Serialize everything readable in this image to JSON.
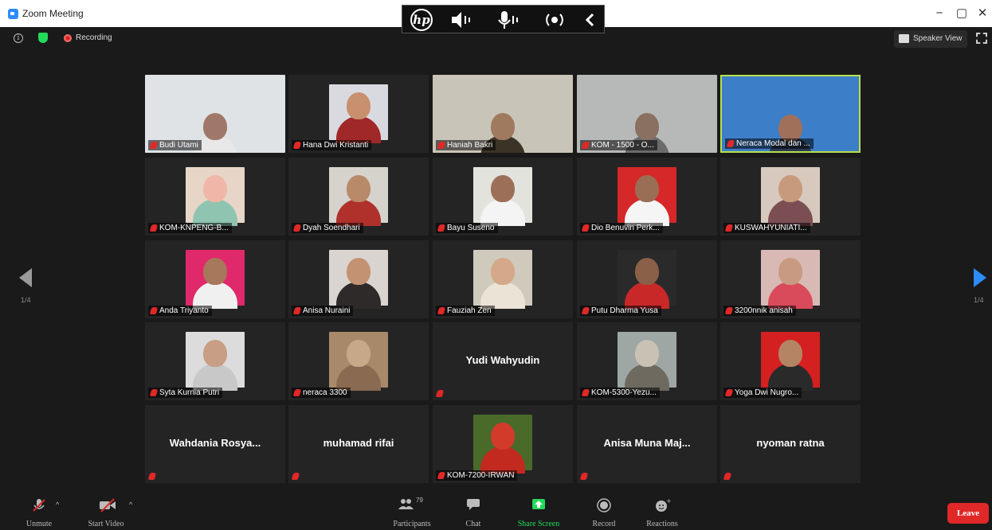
{
  "window": {
    "title": "Zoom Meeting",
    "min": "−",
    "restore": "▢",
    "close": "✕"
  },
  "hp_bar": {
    "logo": "hp",
    "items": [
      "speaker-icon",
      "mic-icon",
      "broadcast-icon",
      "collapse-icon"
    ]
  },
  "top": {
    "recording": "Recording",
    "speaker_view": "Speaker View"
  },
  "pagination": {
    "left": "1/4",
    "right": "1/4"
  },
  "participants": [
    {
      "name": "Budi Utami",
      "video": true,
      "bg": "#dfe3e6",
      "skin": "#a0786a",
      "cloth": "#e8e8e8",
      "full": true
    },
    {
      "name": "Hana Dwi Kristanti",
      "video": true,
      "bg": "#d9dadf",
      "skin": "#c8906e",
      "cloth": "#a02828"
    },
    {
      "name": "Haniah Bakri",
      "video": true,
      "bg": "#c9c4b8",
      "skin": "#a07a5e",
      "cloth": "#3a3326",
      "full": true
    },
    {
      "name": "KOM - 1500 - O...",
      "video": true,
      "bg": "#b6b9b7",
      "skin": "#8a7060",
      "cloth": "#6b6b6b",
      "full": true
    },
    {
      "name": "Neraca Modal dan ...",
      "video": true,
      "bg": "#3d7ec8",
      "skin": "#a0705a",
      "cloth": "#2a3b52",
      "full": true,
      "active": true
    },
    {
      "name": "KOM-KNPENG-B...",
      "video": true,
      "bg": "#e7d6c8",
      "skin": "#f0b7a8",
      "cloth": "#8fc4b0"
    },
    {
      "name": "Dyah Soendhari",
      "video": true,
      "bg": "#d6d2cc",
      "skin": "#b88a6a",
      "cloth": "#b0302c"
    },
    {
      "name": "Bayu Suseno",
      "video": true,
      "bg": "#e3e3de",
      "skin": "#9c7058",
      "cloth": "#f4f4f4"
    },
    {
      "name": "Dio Benuvin Perk...",
      "video": true,
      "bg": "#d62828",
      "skin": "#9a6e54",
      "cloth": "#f5f5f5"
    },
    {
      "name": "KUSWAHYUNIATI...",
      "video": true,
      "bg": "#d7c9bd",
      "skin": "#c89a7c",
      "cloth": "#7b4e54"
    },
    {
      "name": "Anda Triyanto",
      "video": true,
      "bg": "#e0296a",
      "skin": "#a8785c",
      "cloth": "#f0f0f0"
    },
    {
      "name": "Anisa Nuraini",
      "video": true,
      "bg": "#d9d4cf",
      "skin": "#c39272",
      "cloth": "#2e2a2a"
    },
    {
      "name": "Fauziah Zen",
      "video": true,
      "bg": "#cfcabc",
      "skin": "#d4a888",
      "cloth": "#eae3d6"
    },
    {
      "name": "Putu Dharma Yusa",
      "video": true,
      "bg": "#2a2a2a",
      "skin": "#8a6048",
      "cloth": "#c82828"
    },
    {
      "name": "3200nnik anisah",
      "video": true,
      "bg": "#d8b9b4",
      "skin": "#c99a82",
      "cloth": "#d94a5a"
    },
    {
      "name": "Syta Kurnia Putri",
      "video": true,
      "bg": "#dcdcdc",
      "skin": "#c89e84",
      "cloth": "#c8c8c8"
    },
    {
      "name": "neraca 3300",
      "video": true,
      "bg": "#a88a6a",
      "skin": "#c7a98a",
      "cloth": "#8a6a50"
    },
    {
      "name": "Yudi Wahyudin",
      "video": false
    },
    {
      "name": "KOM-5300-Yezu...",
      "video": true,
      "bg": "#9ea7a4",
      "skin": "#c9c2b4",
      "cloth": "#6e6a60"
    },
    {
      "name": "Yoga Dwi Nugro...",
      "video": true,
      "bg": "#d42020",
      "skin": "#b58464",
      "cloth": "#2a2a2a"
    },
    {
      "name": "Wahdania  Rosya...",
      "video": false
    },
    {
      "name": "muhamad rifai",
      "video": false
    },
    {
      "name": "KOM-7200-IRWAN",
      "video": true,
      "bg": "#4a6a2a",
      "skin": "#d23a2a",
      "cloth": "#c22a20"
    },
    {
      "name": "Anisa  Muna  Maj...",
      "video": false
    },
    {
      "name": "nyoman ratna",
      "video": false
    }
  ],
  "toolbar": {
    "unmute": "Unmute",
    "start_video": "Start Video",
    "participants": "Participants",
    "participant_count": "79",
    "chat": "Chat",
    "share_screen": "Share Screen",
    "record": "Record",
    "reactions": "Reactions",
    "leave": "Leave",
    "share_color": "#23d959",
    "leave_color": "#e02828"
  }
}
